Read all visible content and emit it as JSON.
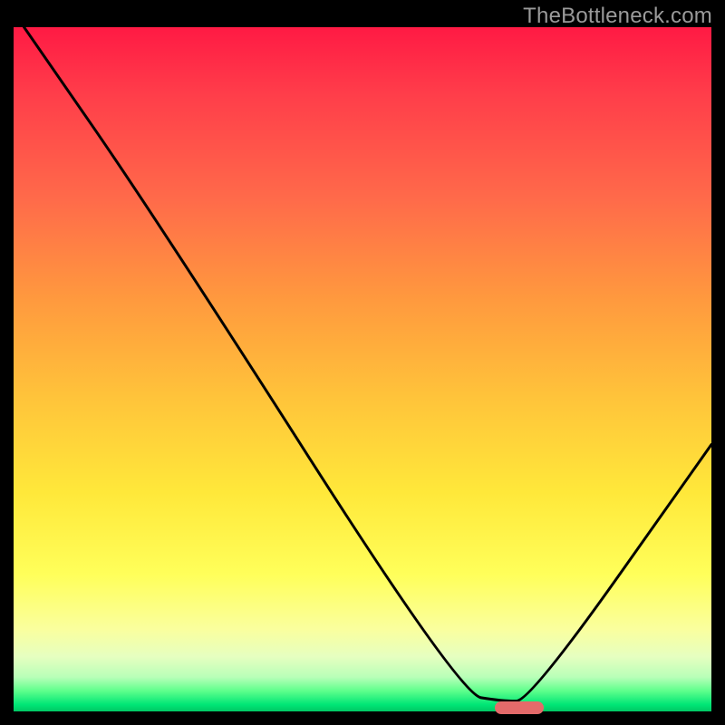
{
  "watermark": "TheBottleneck.com",
  "chart_data": {
    "type": "line",
    "title": "",
    "xlabel": "",
    "ylabel": "",
    "xlim": [
      0,
      100
    ],
    "ylim": [
      0,
      100
    ],
    "curve_points": [
      {
        "x": 1.5,
        "y": 100
      },
      {
        "x": 20.5,
        "y": 72
      },
      {
        "x": 64,
        "y": 2.5
      },
      {
        "x": 70,
        "y": 1.5
      },
      {
        "x": 74,
        "y": 1.5
      },
      {
        "x": 100,
        "y": 39
      }
    ],
    "minimum_marker": {
      "x_start": 69,
      "x_end": 76,
      "y": 0.5
    },
    "background_gradient": {
      "top": "#ff1a44",
      "mid": "#ffe83a",
      "bottom": "#00c864"
    }
  }
}
